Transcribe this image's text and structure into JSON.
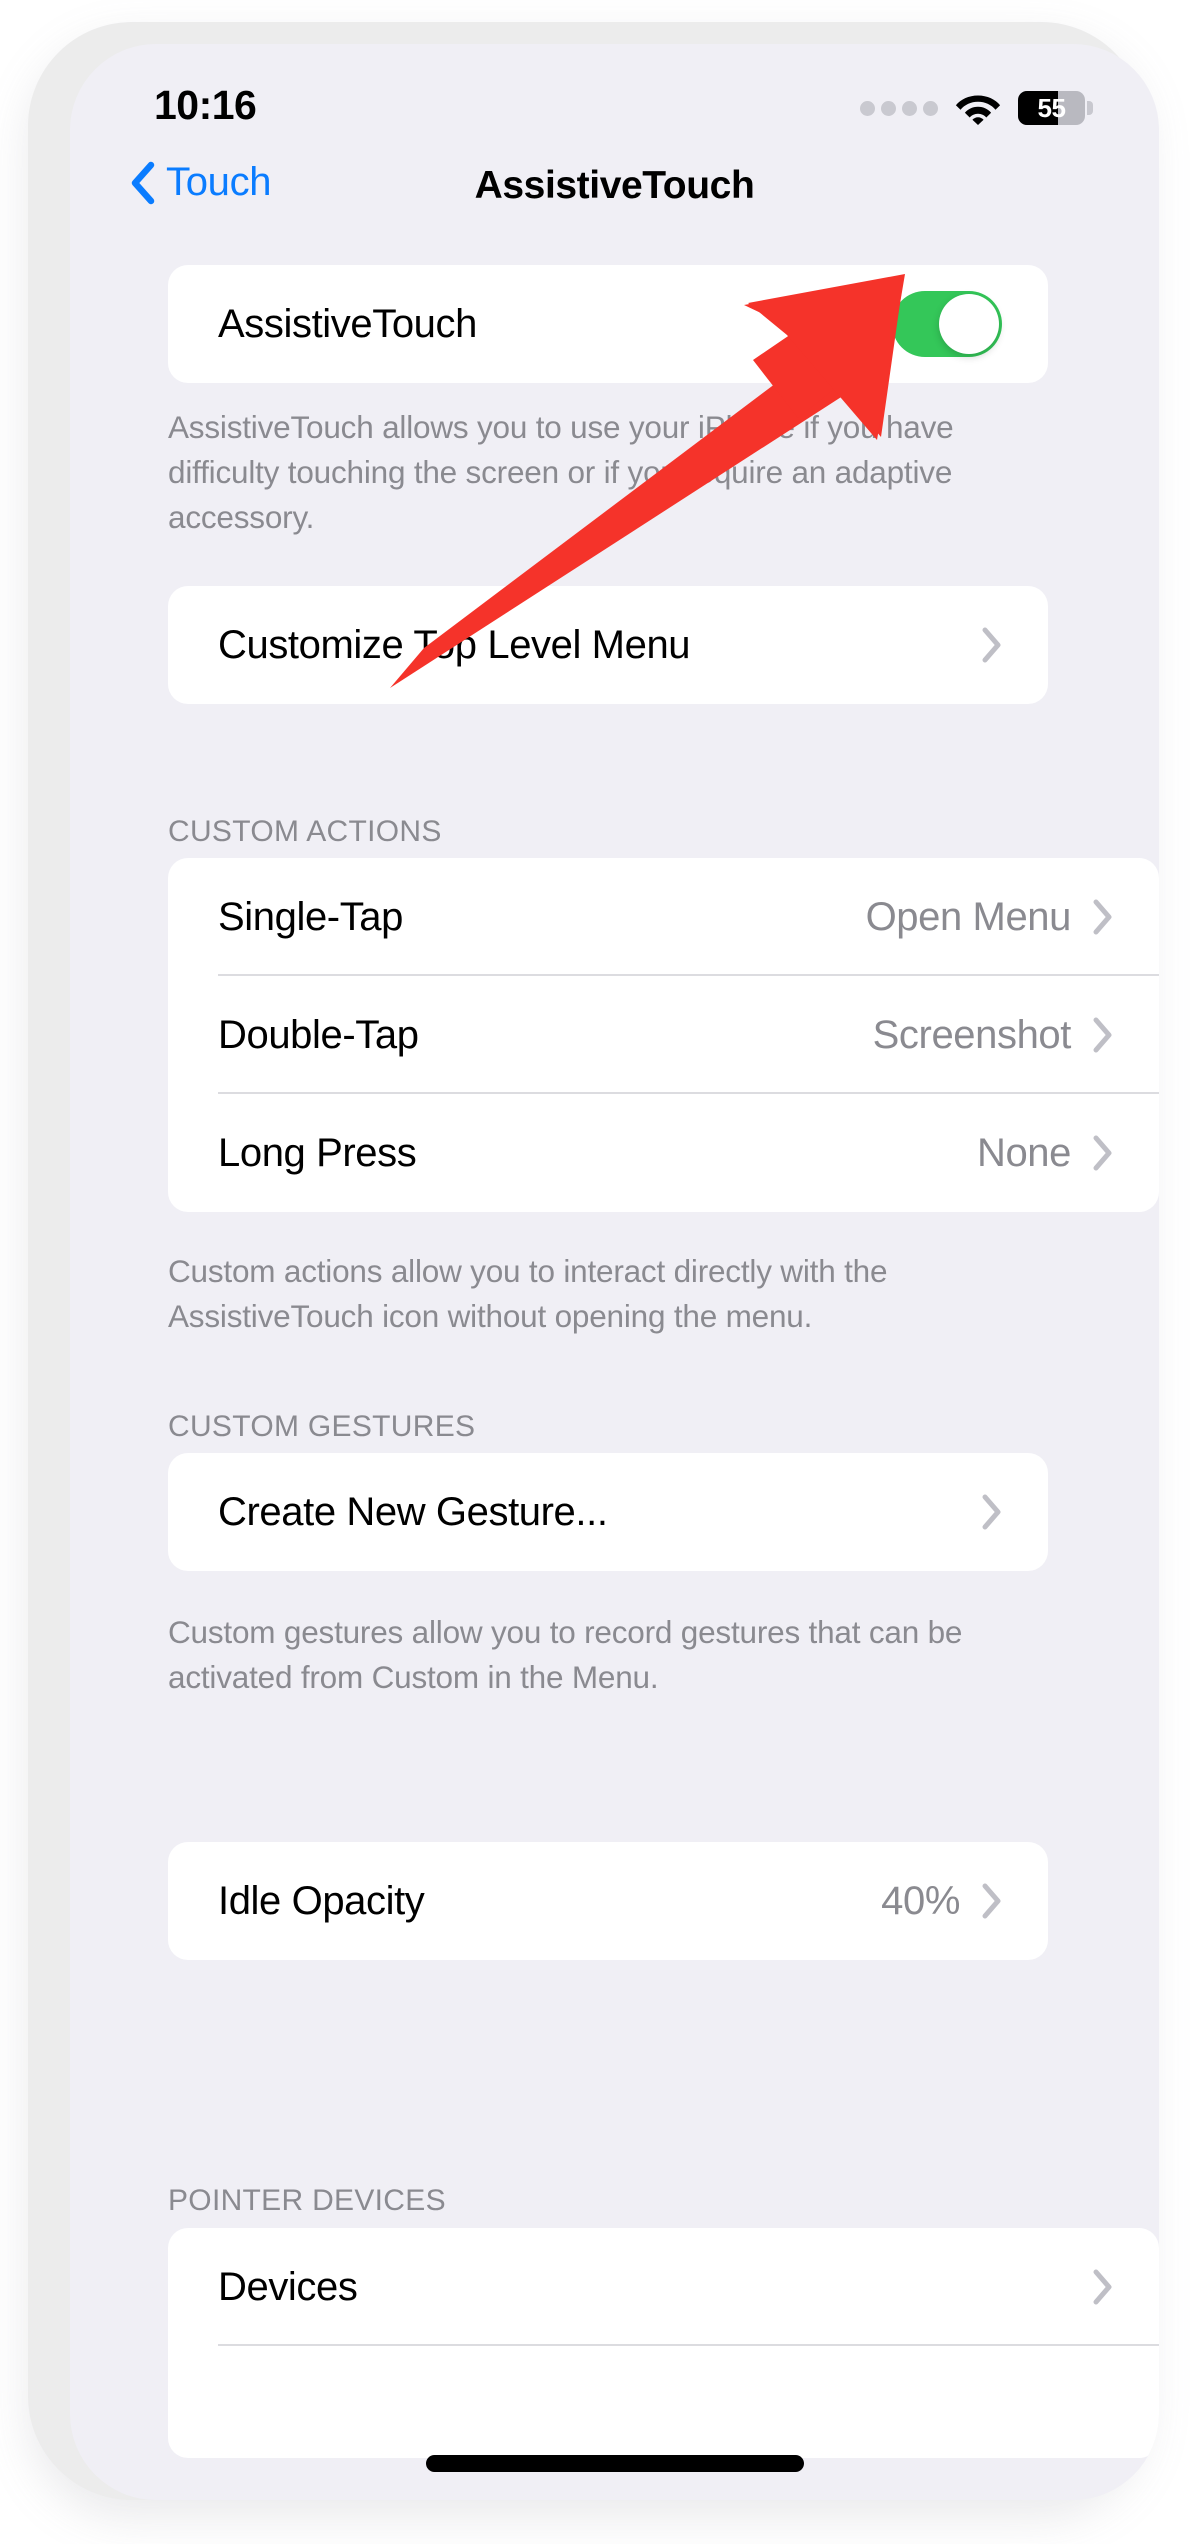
{
  "status_bar": {
    "time": "10:16",
    "cellular_icon": "signal-dots-icon",
    "wifi_icon": "wifi-icon",
    "battery_icon": "battery-icon",
    "battery_percent": "55",
    "battery_level_fraction": 0.6
  },
  "nav_bar": {
    "back_label": "Touch",
    "back_icon": "chevron-left-icon",
    "title": "AssistiveTouch"
  },
  "main_toggle": {
    "label": "AssistiveTouch",
    "state": "on",
    "accent_color": "#34c759"
  },
  "toggle_footer": "AssistiveTouch allows you to use your iPhone if you have difficulty touching the screen or if you require an adaptive accessory.",
  "customize_row": {
    "label": "Customize Top Level Menu",
    "chevron_icon": "chevron-right-icon"
  },
  "custom_actions": {
    "header": "CUSTOM ACTIONS",
    "rows": [
      {
        "label": "Single-Tap",
        "value": "Open Menu",
        "chevron_icon": "chevron-right-icon"
      },
      {
        "label": "Double-Tap",
        "value": "Screenshot",
        "chevron_icon": "chevron-right-icon"
      },
      {
        "label": "Long Press",
        "value": "None",
        "chevron_icon": "chevron-right-icon"
      }
    ],
    "footer": "Custom actions allow you to interact directly with the AssistiveTouch icon without opening the menu."
  },
  "custom_gestures": {
    "header": "CUSTOM GESTURES",
    "rows": [
      {
        "label": "Create New Gesture...",
        "chevron_icon": "chevron-right-icon"
      }
    ],
    "footer": "Custom gestures allow you to record gestures that can be activated from Custom in the Menu."
  },
  "idle_opacity": {
    "label": "Idle Opacity",
    "value": "40%",
    "chevron_icon": "chevron-right-icon"
  },
  "pointer_devices": {
    "header": "POINTER DEVICES",
    "rows": [
      {
        "label": "Devices",
        "chevron_icon": "chevron-right-icon"
      }
    ]
  },
  "annotation": {
    "type": "arrow",
    "color": "#f5332a",
    "points_to": "assistivetouch-toggle"
  },
  "colors": {
    "screen_background": "#f0eff5",
    "card_background": "#ffffff",
    "accent_blue": "#0a7cff",
    "toggle_green": "#34c759",
    "secondary_text": "#8a8a90",
    "separator": "#dcdce0",
    "annotation_red": "#f5332a"
  }
}
